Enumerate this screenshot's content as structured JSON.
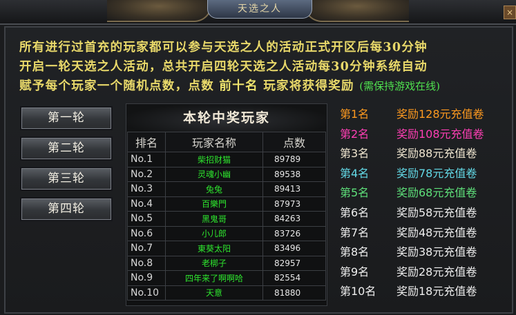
{
  "window": {
    "title": "天选之人",
    "close_label": "×"
  },
  "notice": {
    "line1": "所有进行过首充的玩家都可以参与天选之人的活动正式开区后每30分钟",
    "line2": "开启一轮天选之人活动，总共开启四轮天选之人活动每30分钟系统自动",
    "line3_a": "赋予每个玩家一个随机点数，点数",
    "line3_b": "前十名",
    "line3_c": "玩家将获得奖励",
    "line3_tail": "(需保持游戏在线)"
  },
  "rounds": [
    "第一轮",
    "第二轮",
    "第三轮",
    "第四轮"
  ],
  "winners": {
    "title": "本轮中奖玩家",
    "headers": [
      "排名",
      "玩家名称",
      "点数"
    ],
    "rows": [
      {
        "rank": "No.1",
        "name": "柴招财猫",
        "score": "89789"
      },
      {
        "rank": "No.2",
        "name": "灵魂小幽",
        "score": "89538"
      },
      {
        "rank": "No.3",
        "name": "兔兔",
        "score": "89413"
      },
      {
        "rank": "No.4",
        "name": "百樂門",
        "score": "87973"
      },
      {
        "rank": "No.5",
        "name": "黑鬼哥",
        "score": "84263"
      },
      {
        "rank": "No.6",
        "name": "小儿郎",
        "score": "83726"
      },
      {
        "rank": "No.7",
        "name": "東葵太阳",
        "score": "83496"
      },
      {
        "rank": "No.8",
        "name": "老梆子",
        "score": "82957"
      },
      {
        "rank": "No.9",
        "name": "四年来了啊啊哈",
        "score": "82554"
      },
      {
        "rank": "No.10",
        "name": "天意",
        "score": "81880"
      }
    ]
  },
  "rewards": [
    {
      "rank": "第1名",
      "reward": "奖励128元充值卷",
      "color": "#ff9a1f"
    },
    {
      "rank": "第2名",
      "reward": "奖励108元充值卷",
      "color": "#ff3fb4"
    },
    {
      "rank": "第3名",
      "reward": "奖励88元充值卷",
      "color": "#f0e6d0"
    },
    {
      "rank": "第4名",
      "reward": "奖励78元充值卷",
      "color": "#63d9e6"
    },
    {
      "rank": "第5名",
      "reward": "奖励68元充值卷",
      "color": "#5ee07a"
    },
    {
      "rank": "第6名",
      "reward": "奖励58元充值卷",
      "color": "#eeeeee"
    },
    {
      "rank": "第7名",
      "reward": "奖励48元充值卷",
      "color": "#eeeeee"
    },
    {
      "rank": "第8名",
      "reward": "奖励38元充值卷",
      "color": "#eeeeee"
    },
    {
      "rank": "第9名",
      "reward": "奖励28元充值卷",
      "color": "#eeeeee"
    },
    {
      "rank": "第10名",
      "reward": "奖励18元充值卷",
      "color": "#eeeeee"
    }
  ]
}
